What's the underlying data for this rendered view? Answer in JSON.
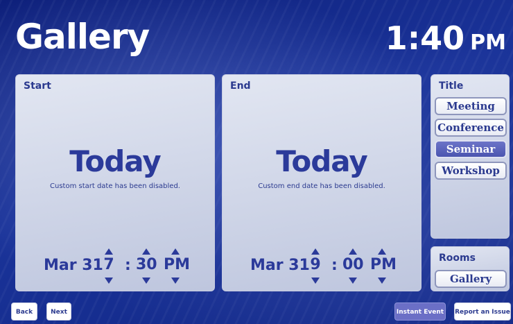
{
  "header": {
    "title": "Gallery",
    "time": "1:40",
    "ampm": "PM"
  },
  "start": {
    "label": "Start",
    "today": "Today",
    "note": "Custom start date has been disabled.",
    "date": "Mar 31",
    "hour": "7",
    "colon": ":",
    "minute": "30",
    "ampm": "PM"
  },
  "end": {
    "label": "End",
    "today": "Today",
    "note": "Custom end date has been disabled.",
    "date": "Mar 31",
    "hour": "9",
    "colon": ":",
    "minute": "00",
    "ampm": "PM"
  },
  "title_panel": {
    "label": "Title",
    "options": [
      "Meeting",
      "Conference",
      "Seminar",
      "Workshop"
    ],
    "selected": "Seminar"
  },
  "rooms_panel": {
    "label": "Rooms",
    "options": [
      "Gallery"
    ]
  },
  "footer": {
    "back": "Back",
    "next": "Next",
    "instant_event": "Instant Event",
    "report_issue": "Report an Issue"
  },
  "colors": {
    "accent": "#2b3a9a",
    "selected": "#5a62bd",
    "background": "#1a3399"
  }
}
